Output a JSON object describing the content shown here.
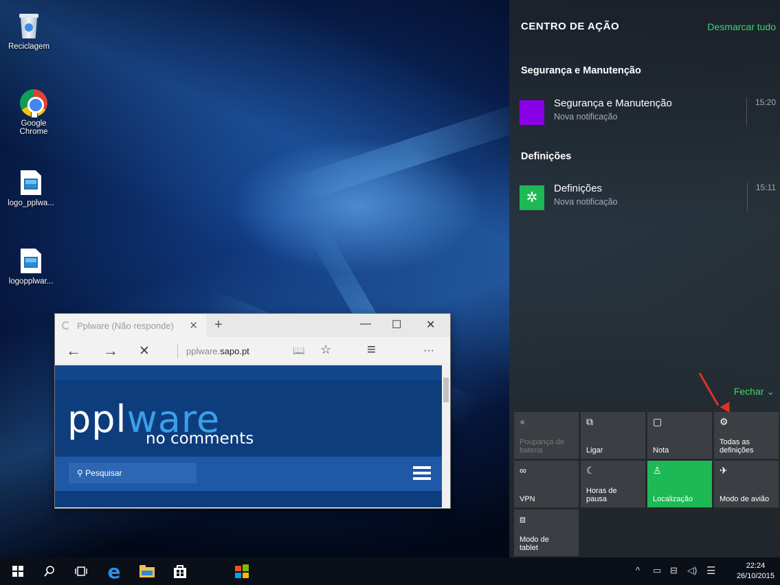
{
  "desktop": {
    "icons": [
      {
        "label": "Reciclagem",
        "icon": "recycle-bin-icon"
      },
      {
        "label": "Google Chrome",
        "icon": "chrome-icon"
      },
      {
        "label": "logo_pplwa...",
        "icon": "image-file-icon"
      },
      {
        "label": "logopplwar...",
        "icon": "image-file-icon"
      }
    ]
  },
  "browser": {
    "tab_title": "Pplware (Não responde)",
    "tab_close": "✕",
    "new_tab": "+",
    "minimize": "—",
    "maximize": "☐",
    "close": "✕",
    "back": "←",
    "forward": "→",
    "stop": "✕",
    "url_prefix": "pplware.",
    "url_domain": "sapo.pt",
    "reading_view": "📖",
    "favorite": "☆",
    "hub": "≡",
    "more": "···",
    "page": {
      "logo_part1": "ppl",
      "logo_part2": "ware",
      "tagline": "no comments",
      "search_placeholder": "Pesquisar",
      "search_icon": "search-icon"
    }
  },
  "action_center": {
    "title": "CENTRO DE AÇÃO",
    "clear_all": "Desmarcar tudo",
    "groups": [
      {
        "name": "Segurança e Manutenção",
        "notifications": [
          {
            "title": "Segurança e Manutenção",
            "subtitle": "Nova notificação",
            "time": "15:20",
            "icon_color": "#8a00e6"
          }
        ]
      },
      {
        "name": "Definições",
        "notifications": [
          {
            "title": "Definições",
            "subtitle": "Nova notificação",
            "time": "15:11",
            "icon_color": "#1db954"
          }
        ]
      }
    ],
    "collapse": "Fechar ⌄",
    "quick_actions": [
      {
        "label": "Poupança de bateria",
        "icon": "battery-saver-icon",
        "state": "disabled"
      },
      {
        "label": "Ligar",
        "icon": "connect-icon",
        "state": "off"
      },
      {
        "label": "Nota",
        "icon": "note-icon",
        "state": "off"
      },
      {
        "label": "Todas as definições",
        "icon": "gear-icon",
        "state": "off"
      },
      {
        "label": "VPN",
        "icon": "vpn-icon",
        "state": "off"
      },
      {
        "label": "Horas de pausa",
        "icon": "moon-icon",
        "state": "off"
      },
      {
        "label": "Localização",
        "icon": "location-icon",
        "state": "on"
      },
      {
        "label": "Modo de avião",
        "icon": "airplane-icon",
        "state": "off"
      },
      {
        "label": "Modo de tablet",
        "icon": "tablet-mode-icon",
        "state": "off"
      }
    ],
    "accent_color": "#3ed66f"
  },
  "taskbar": {
    "time": "22:24",
    "date": "26/10/2015",
    "tray_chevron": "^"
  }
}
